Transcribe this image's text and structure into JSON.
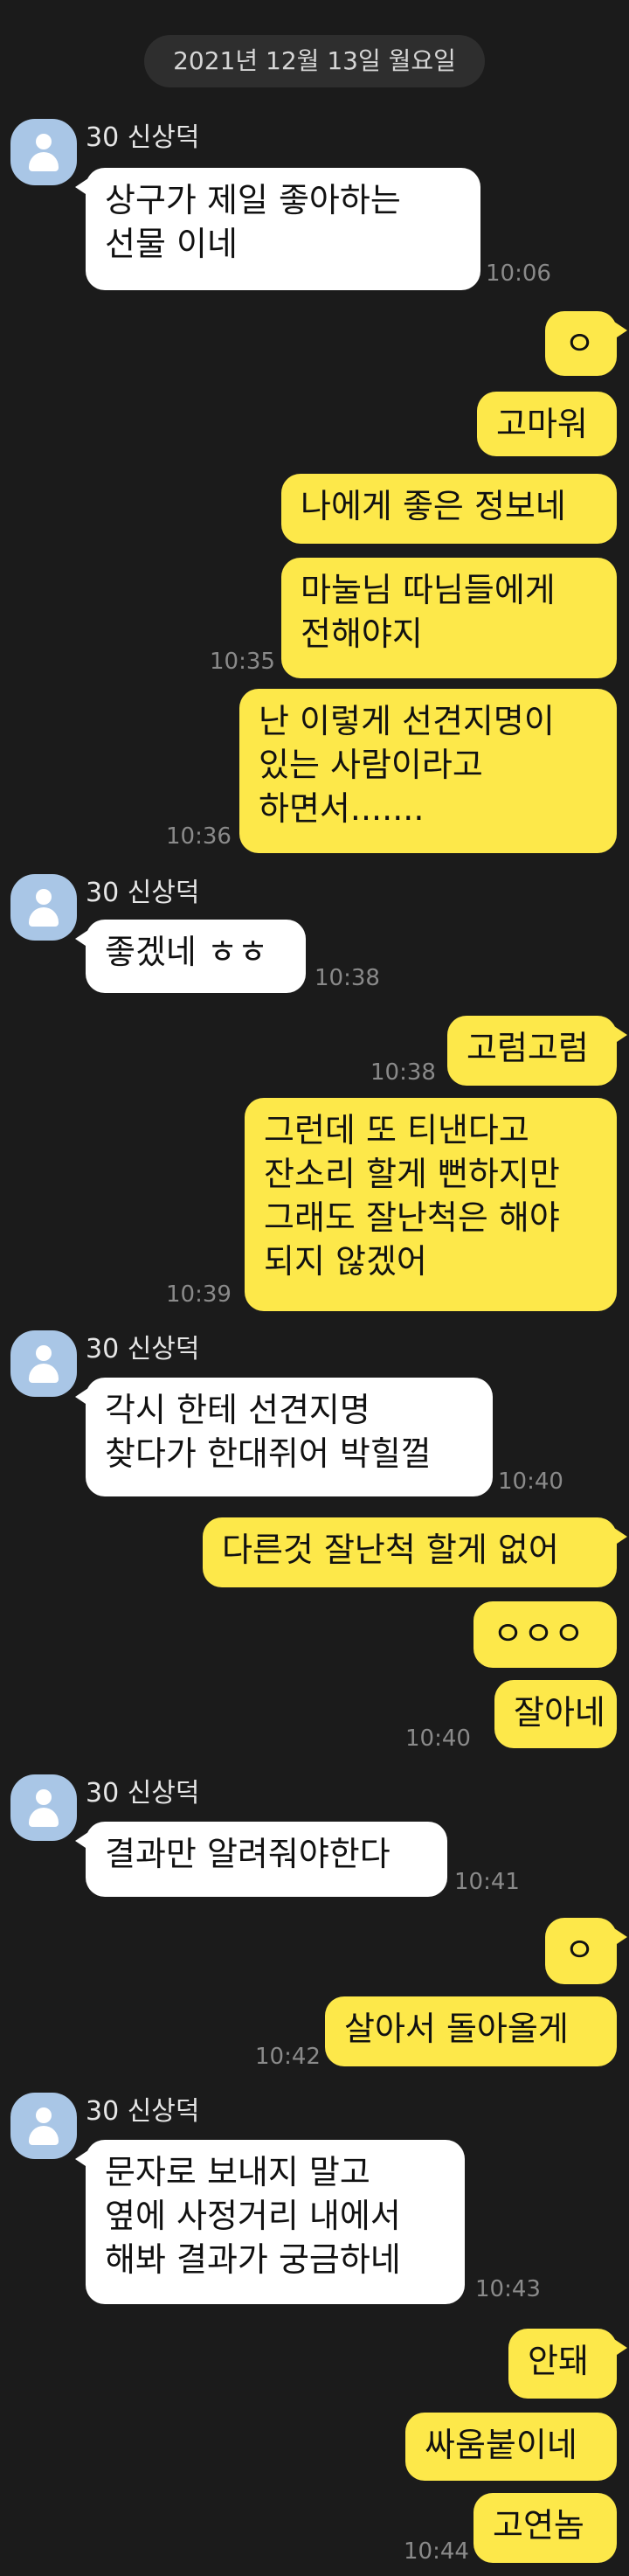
{
  "date_divider": "2021년 12월 13일 월요일",
  "messages": [
    {
      "side": "in",
      "sender": "30 신상덕",
      "lines": [
        "상구가 제일 좋아하는",
        "선물 이네"
      ],
      "time": "10:06"
    },
    {
      "side": "out",
      "text": "ㅇ"
    },
    {
      "side": "out",
      "text": "고마워"
    },
    {
      "side": "out",
      "text": "나에게 좋은 정보네"
    },
    {
      "side": "out",
      "lines": [
        "마눌님 따님들에게",
        "전해야지"
      ],
      "time": "10:35"
    },
    {
      "side": "out",
      "lines": [
        "난 이렇게 선견지명이",
        "있는 사람이라고",
        "하면서......."
      ],
      "time": "10:36"
    },
    {
      "side": "in",
      "sender": "30 신상덕",
      "text": "좋겠네 ㅎㅎ",
      "time": "10:38"
    },
    {
      "side": "out",
      "text": "고럼고럼",
      "time": "10:38"
    },
    {
      "side": "out",
      "lines": [
        "그런데 또 티낸다고",
        "잔소리 할게 뻔하지만",
        "그래도 잘난척은 해야",
        "되지 않겠어"
      ],
      "time": "10:39"
    },
    {
      "side": "in",
      "sender": "30 신상덕",
      "lines": [
        "각시 한테 선견지명",
        "찾다가 한대쥐어 박힐껄"
      ],
      "time": "10:40"
    },
    {
      "side": "out",
      "text": "다른것 잘난척 할게 없어"
    },
    {
      "side": "out",
      "text": "ㅇㅇㅇ"
    },
    {
      "side": "out",
      "text": "잘아네",
      "time": "10:40"
    },
    {
      "side": "in",
      "sender": "30 신상덕",
      "text": "결과만 알려줘야한다",
      "time": "10:41"
    },
    {
      "side": "out",
      "text": "ㅇ"
    },
    {
      "side": "out",
      "text": "살아서 돌아올게",
      "time": "10:42"
    },
    {
      "side": "in",
      "sender": "30 신상덕",
      "lines": [
        "문자로 보내지 말고",
        "옆에 사정거리 내에서",
        "해봐 결과가 궁금하네"
      ],
      "time": "10:43"
    },
    {
      "side": "out",
      "text": "안돼"
    },
    {
      "side": "out",
      "text": "싸움붙이네"
    },
    {
      "side": "out",
      "text": "고연놈",
      "time": "10:44"
    }
  ],
  "colors": {
    "background": "#1b1b1b",
    "incoming_bubble": "#ffffff",
    "outgoing_bubble": "#fde84a",
    "timestamp": "#8a8a8a"
  },
  "icons": {
    "avatar": "default-profile-icon"
  }
}
